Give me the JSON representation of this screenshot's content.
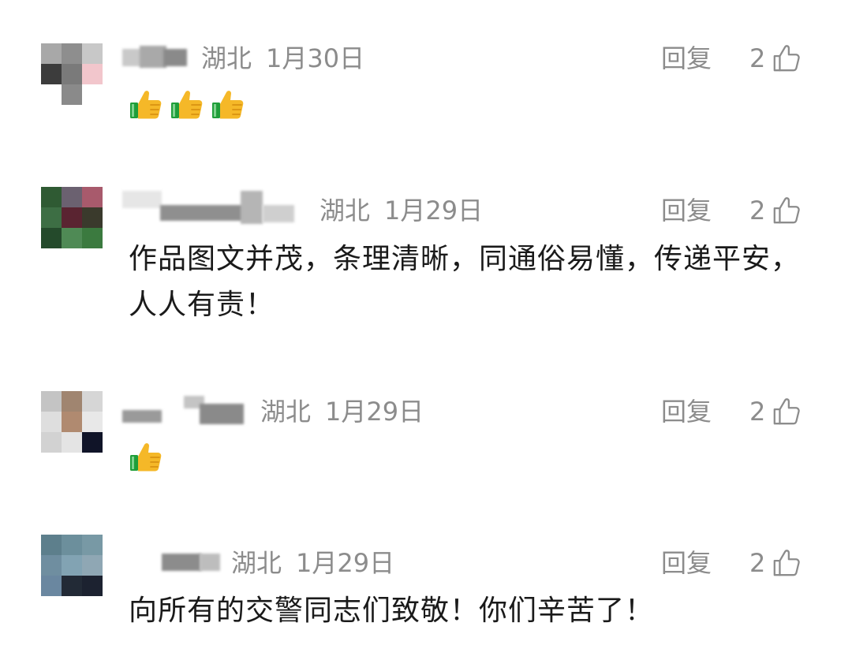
{
  "comments": [
    {
      "region": "湖北",
      "date": "1月30日",
      "reply_label": "回复",
      "like_count": "2",
      "text": "",
      "emoji": [
        "thumbs-up-emoji",
        "thumbs-up-emoji",
        "thumbs-up-emoji"
      ]
    },
    {
      "region": "湖北",
      "date": "1月29日",
      "reply_label": "回复",
      "like_count": "2",
      "text": "作品图文并茂，条理清晰，同通俗易懂，传递平安，人人有责！",
      "emoji": []
    },
    {
      "region": "湖北",
      "date": "1月29日",
      "reply_label": "回复",
      "like_count": "2",
      "text": "",
      "emoji": [
        "thumbs-up-emoji"
      ]
    },
    {
      "region": "湖北",
      "date": "1月29日",
      "reply_label": "回复",
      "like_count": "2",
      "text": "向所有的交警同志们致敬！你们辛苦了！",
      "emoji": []
    }
  ],
  "colors": {
    "meta_text": "#8c8c8c",
    "body_text": "#1a1a1a",
    "background": "#ffffff",
    "emoji_sleeve": "#1f9e3a",
    "emoji_hand": "#f5b828"
  }
}
